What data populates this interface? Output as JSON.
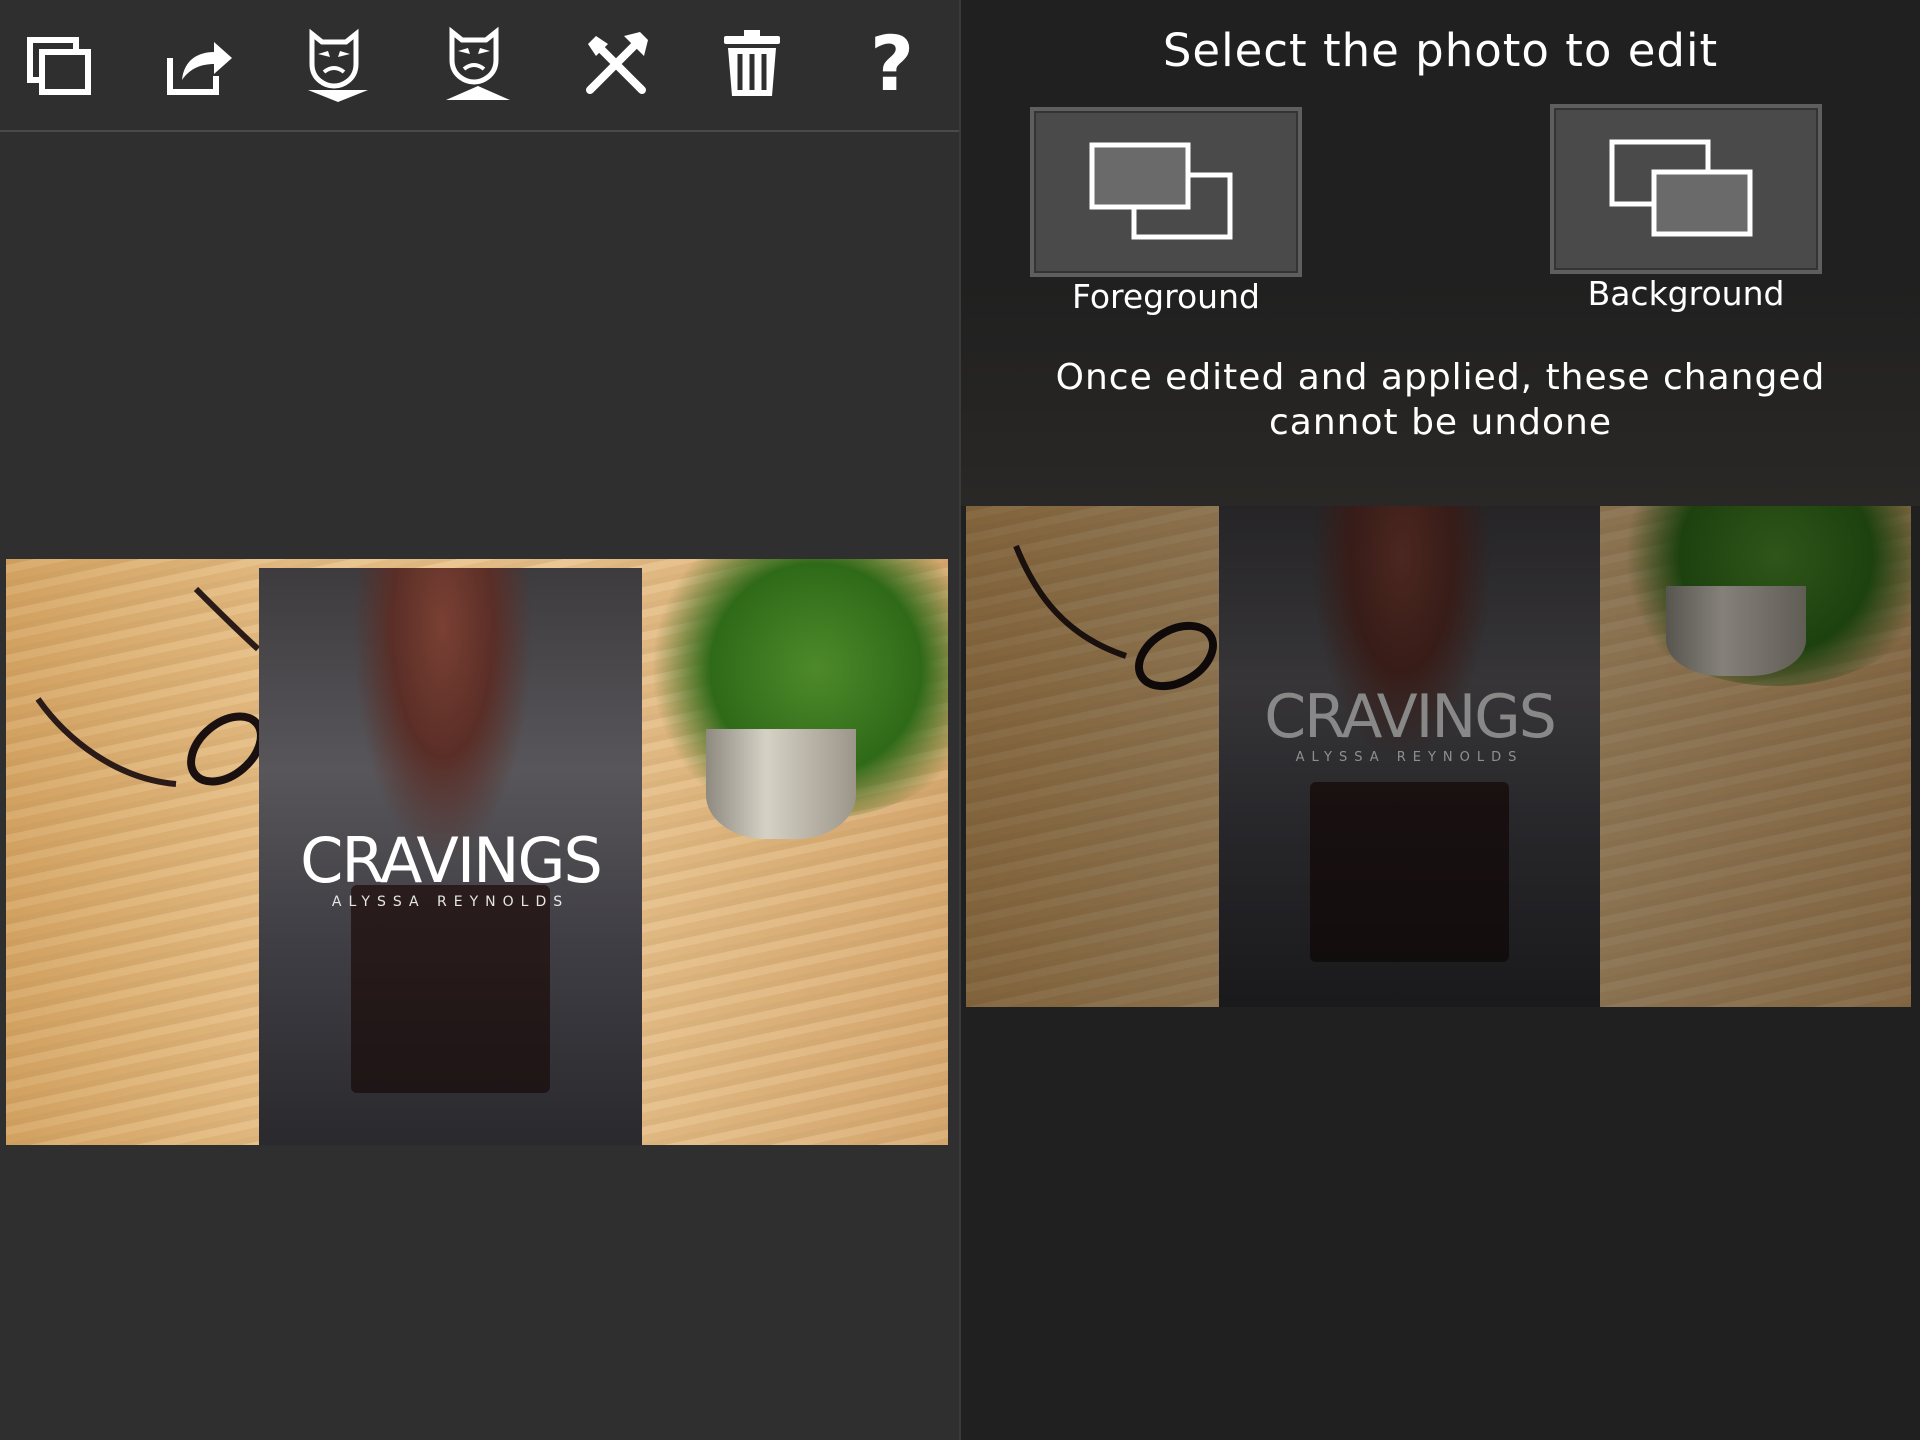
{
  "toolbar": {
    "buttons": [
      {
        "icon": "layers-icon",
        "label": "layers"
      },
      {
        "icon": "share-icon",
        "label": "share"
      },
      {
        "icon": "mask-down-icon",
        "label": "mask-down"
      },
      {
        "icon": "mask-up-icon",
        "label": "mask-up"
      },
      {
        "icon": "tools-icon",
        "label": "tools"
      },
      {
        "icon": "trash-icon",
        "label": "delete"
      },
      {
        "icon": "help-icon",
        "label": "help",
        "glyph": "?"
      }
    ]
  },
  "canvas": {
    "cover_title": "CRAVINGS",
    "cover_author": "ALYSSA REYNOLDS"
  },
  "selector": {
    "title": "Select the photo to edit",
    "foreground_label": "Foreground",
    "background_label": "Background",
    "warning_line1": "Once edited and applied, these changed",
    "warning_line2": "cannot be undone"
  },
  "preview": {
    "cover_title": "CRAVINGS",
    "cover_author": "ALYSSA REYNOLDS"
  },
  "colors": {
    "panel_left": "#2f2f2f",
    "panel_right": "#202020",
    "button_face": "#4a4a4a",
    "icon": "#ffffff"
  }
}
